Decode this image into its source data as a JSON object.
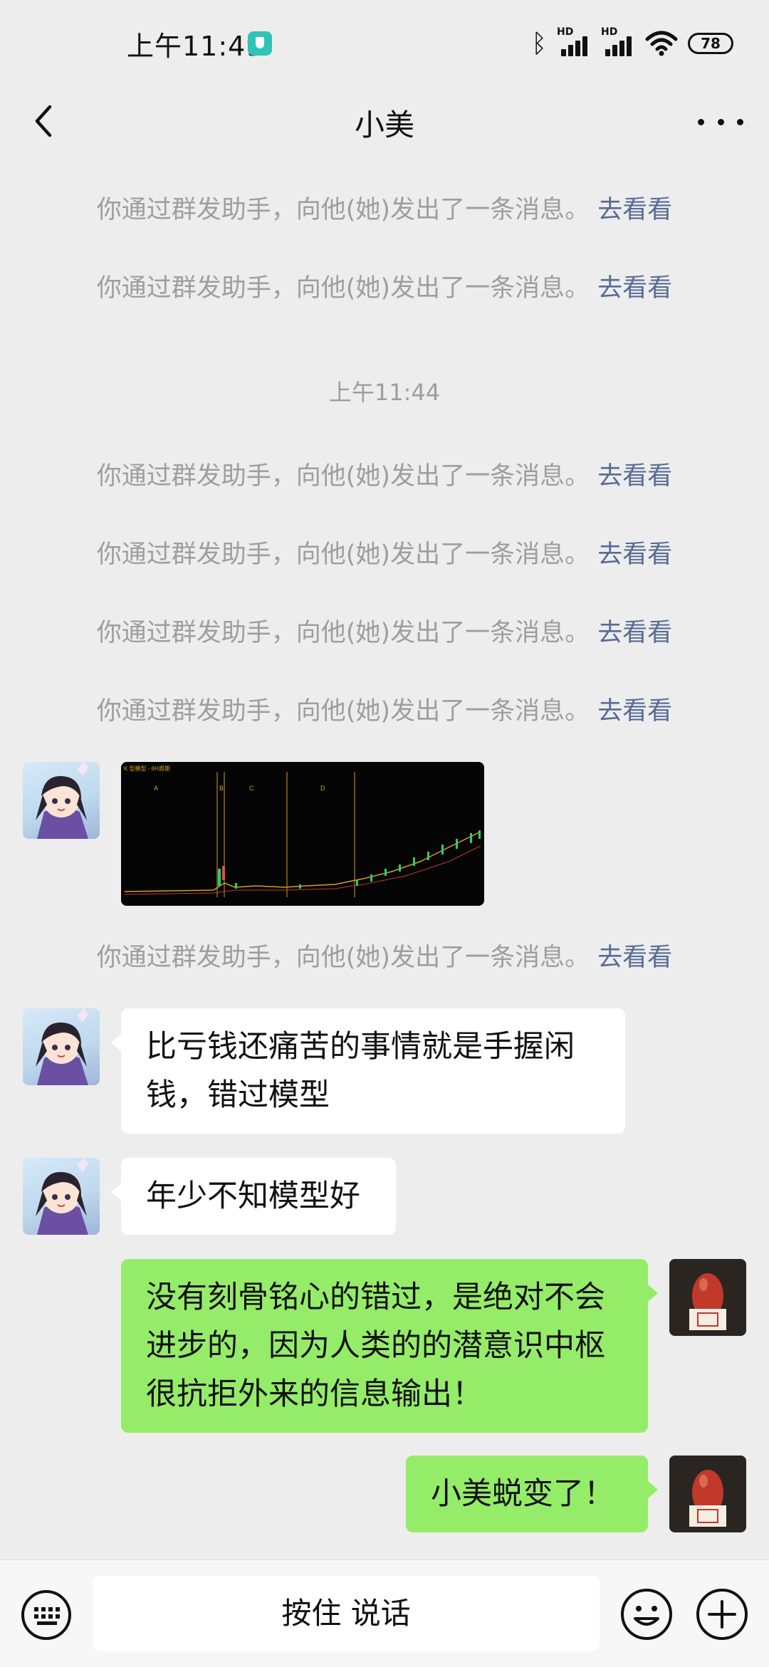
{
  "status_bar": {
    "time": "上午11:49",
    "battery": "78",
    "signal_label_1": "HD",
    "signal_label_2": "HD"
  },
  "nav": {
    "title": "小美"
  },
  "system_message": {
    "text": "你通过群发助手，向他(她)发出了一条消息。",
    "link": "去看看"
  },
  "timestamp": "上午11:44",
  "chart_image": {
    "header": "K 型模型 - 6H周期",
    "labels": [
      "A",
      "B",
      "C",
      "D"
    ],
    "colors": {
      "up": "#2ECC71",
      "down": "#E74C3C",
      "line": "#D4A017"
    }
  },
  "messages": [
    {
      "side": "left",
      "text": "比亏钱还痛苦的事情就是手握闲钱，错过模型"
    },
    {
      "side": "left",
      "text": "年少不知模型好"
    },
    {
      "side": "right",
      "text": "没有刻骨铭心的错过，是绝对不会进步的，因为人类的的潜意识中枢很抗拒外来的信息输出！"
    },
    {
      "side": "right",
      "text": "小美蜕变了！"
    }
  ],
  "input_bar": {
    "talk_label": "按住 说话"
  },
  "colors": {
    "background": "#EDEDED",
    "self_bubble": "#95EC69",
    "other_bubble": "#FFFFFF",
    "link": "#576B95"
  }
}
